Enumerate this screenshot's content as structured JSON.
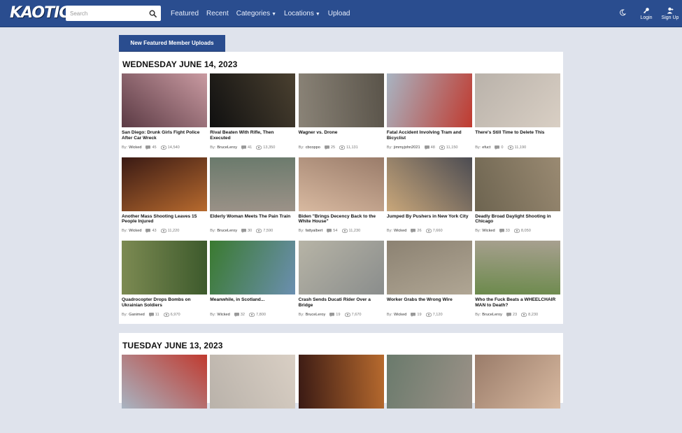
{
  "nav": {
    "logo": "KAOTIC",
    "search_placeholder": "Search",
    "links": [
      "Featured",
      "Recent",
      "Categories",
      "Locations",
      "Upload"
    ],
    "login": "Login",
    "signup": "Sign Up"
  },
  "featured_tab": "New Featured Member Uploads",
  "by_label": "By:",
  "days": [
    {
      "heading": "WEDNESDAY JUNE 14, 2023",
      "videos": [
        {
          "title": "San Diego: Drunk Girls Fight Police After Car Wreck",
          "author": "Wicked",
          "comments": "45",
          "views": "14,540"
        },
        {
          "title": "Rival Beaten With Rifle, Then Executed",
          "author": "BruceLeroy",
          "comments": "41",
          "views": "13,350"
        },
        {
          "title": "Wagner vs. Drone",
          "author": "cbcoppo",
          "comments": "25",
          "views": "11,131"
        },
        {
          "title": "Fatal Accident Involving Tram and Bicyclist",
          "author": "jimmyjohn2021",
          "comments": "48",
          "views": "11,150"
        },
        {
          "title": "There's Still Time to Delete This",
          "author": "efuct",
          "comments": "0",
          "views": "11,190"
        },
        {
          "title": "Another Mass Shooting Leaves 15 People Injured",
          "author": "Wicked",
          "comments": "43",
          "views": "11,220"
        },
        {
          "title": "Elderly Woman Meets The Pain Train",
          "author": "BruceLeroy",
          "comments": "30",
          "views": "7,590"
        },
        {
          "title": "Biden \"Brings Decency Back to the White House\"",
          "author": "fattyalbert",
          "comments": "54",
          "views": "11,230"
        },
        {
          "title": "Jumped By Pushers in New York City",
          "author": "Wicked",
          "comments": "26",
          "views": "7,660"
        },
        {
          "title": "Deadly Broad Daylight Shooting in Chicago",
          "author": "Wicked",
          "comments": "33",
          "views": "8,050"
        },
        {
          "title": "Quadrocopter Drops Bombs on Ukrainian Soldiers",
          "author": "Ganimed",
          "comments": "11",
          "views": "6,970"
        },
        {
          "title": "Meanwhile, in Scotland...",
          "author": "Wicked",
          "comments": "32",
          "views": "7,800"
        },
        {
          "title": "Crash Sends Ducati Rider Over a Bridge",
          "author": "BruceLeroy",
          "comments": "19",
          "views": "7,670"
        },
        {
          "title": "Worker Grabs the Wrong Wire",
          "author": "Wicked",
          "comments": "19",
          "views": "7,120"
        },
        {
          "title": "Who the Fuck Beats a WHEELCHAIR MAN to Death?",
          "author": "BruceLeroy",
          "comments": "23",
          "views": "8,230"
        }
      ]
    },
    {
      "heading": "TUESDAY JUNE 13, 2023",
      "videos": [
        {},
        {},
        {},
        {},
        {}
      ]
    }
  ]
}
